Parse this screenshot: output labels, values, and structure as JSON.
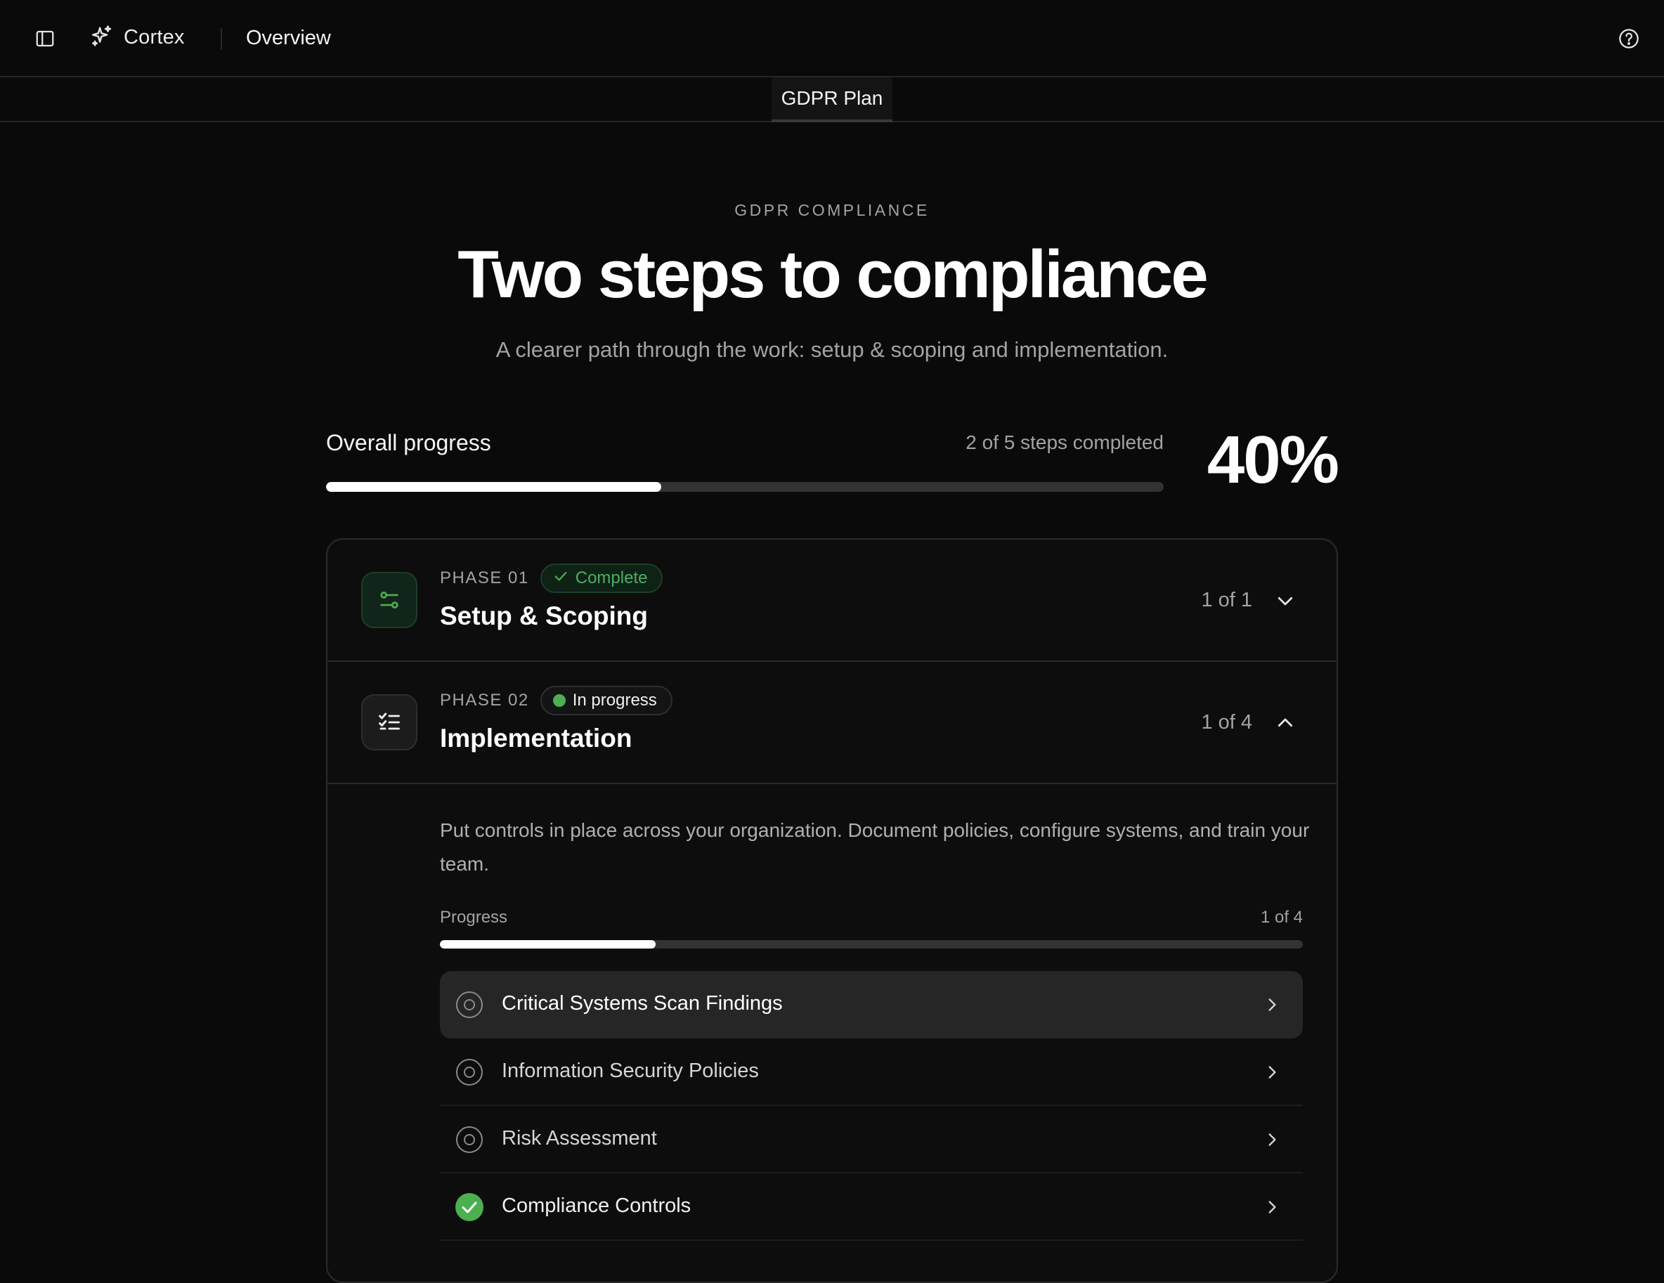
{
  "topbar": {
    "brand": "Cortex",
    "nav_item": "Overview",
    "icons": [
      "sidebar-toggle-icon",
      "sparkles-icon",
      "help-circle-icon"
    ]
  },
  "tabs": [
    {
      "label": "GDPR Plan",
      "active": true
    }
  ],
  "hero": {
    "eyebrow": "GDPR COMPLIANCE",
    "title": "Two steps to compliance",
    "subtitle": "A clearer path through the work: setup & scoping and implementation."
  },
  "overall": {
    "label": "Overall progress",
    "count_text": "2 of 5 steps completed",
    "percent_text": "40%",
    "fraction": 0.4
  },
  "phases": [
    {
      "number": "PHASE 01",
      "status": "Complete",
      "title": "Setup & Scoping",
      "count": "1 of 1",
      "expanded": false,
      "icon": "sliders-icon"
    },
    {
      "number": "PHASE 02",
      "status": "In progress",
      "title": "Implementation",
      "count": "1 of 4",
      "expanded": true,
      "icon": "checklist-icon",
      "description": "Put controls in place across your organization. Document policies, configure systems, and train your team.",
      "progress_label": "Progress",
      "progress_count": "1 of 4",
      "progress_fraction": 0.25,
      "steps": [
        {
          "label": "Critical Systems Scan Findings",
          "done": false,
          "active": true
        },
        {
          "label": "Information Security Policies",
          "done": false,
          "active": false
        },
        {
          "label": "Risk Assessment",
          "done": false,
          "active": false
        },
        {
          "label": "Compliance Controls",
          "done": true,
          "active": false
        }
      ]
    }
  ],
  "colors": {
    "background": "#0a0a0a",
    "accent_green": "#4caf50",
    "bar_fill": "#ffffff",
    "bar_track": "#333333"
  }
}
